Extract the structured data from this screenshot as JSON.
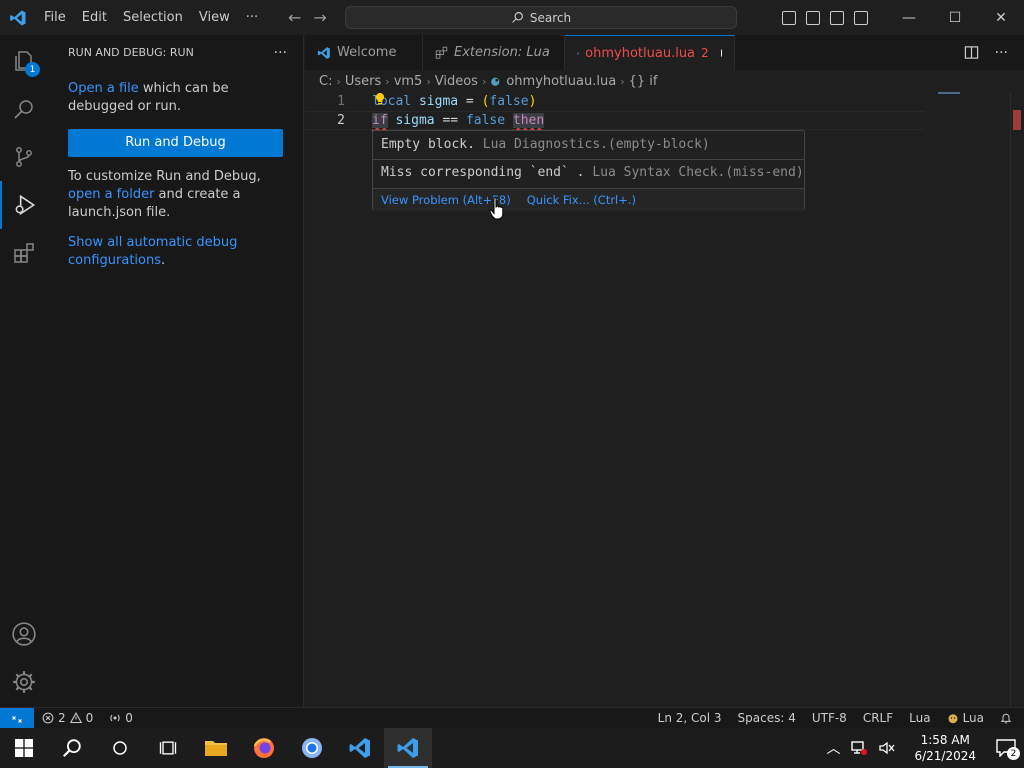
{
  "titlebar": {
    "menu": [
      "File",
      "Edit",
      "Selection",
      "View",
      "···"
    ],
    "search_label": "Search",
    "back_arrow": "←",
    "forward_arrow": "→",
    "minimize": "—",
    "maximize": "☐",
    "close": "✕"
  },
  "activitybar": {
    "explorer_badge": "1",
    "items": [
      "explorer-icon",
      "search-icon",
      "source-control-icon",
      "run-debug-icon",
      "extensions-icon",
      "accounts-icon",
      "manage-gear-icon"
    ]
  },
  "sidebar": {
    "title": "RUN AND DEBUG: RUN",
    "more": "···",
    "p1_link": "Open a file",
    "p1_text": " which can be debugged or run.",
    "run_button": "Run and Debug",
    "p2_text": "To customize Run and Debug, ",
    "p2_link": "open a folder",
    "p2_tail": " and create a launch.json file.",
    "p3_link": "Show all automatic debug configurations",
    "p3_tail": "."
  },
  "tabs": [
    {
      "label": "Welcome"
    },
    {
      "label": "Extension: Lua"
    },
    {
      "label": "ohmyhotluau.lua",
      "count": "2"
    }
  ],
  "breadcrumbs": [
    "C:",
    "Users",
    "vm5",
    "Videos",
    "ohmyhotluau.lua",
    "{} if"
  ],
  "editor": {
    "line_numbers": [
      "1",
      "2"
    ],
    "line1": {
      "kw": "local",
      "var": "sigma",
      "op": " = ",
      "open": "(",
      "val": "false",
      "close": ")"
    },
    "line2": {
      "kw": "if",
      "var": "sigma",
      "op": " == ",
      "val": "false",
      "then": "then"
    }
  },
  "hover": {
    "problem1_msg": "Empty block.",
    "problem1_src": " Lua Diagnostics.(empty-block)",
    "problem2_msg": "Miss corresponding `end` .",
    "problem2_src": " Lua Syntax Check.(miss-end)",
    "view_problem": "View Problem (Alt+F8)",
    "quick_fix": "Quick Fix... (Ctrl+.)"
  },
  "statusbar": {
    "errors": "2",
    "warnings": "0",
    "ports": "0",
    "position": "Ln 2, Col 3",
    "spaces": "Spaces: 4",
    "encoding": "UTF-8",
    "eol": "CRLF",
    "language": "Lua",
    "lua_ext": "Lua"
  },
  "taskbar": {
    "time": "1:58 AM",
    "date": "6/21/2024",
    "notifications": "2"
  },
  "colors": {
    "accent": "#0078d4",
    "error": "#f14c4c",
    "link": "#3794ff"
  }
}
